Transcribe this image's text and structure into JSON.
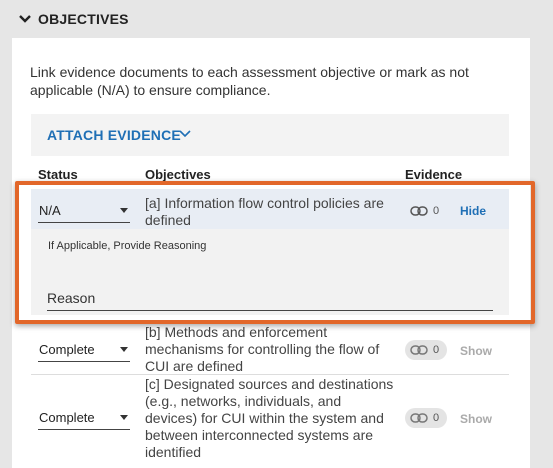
{
  "section": {
    "title": "OBJECTIVES"
  },
  "intro_text": "Link evidence documents to each assessment objective or mark as not applicable (N/A) to ensure compliance.",
  "attach": {
    "label": "ATTACH EVIDENCE"
  },
  "table": {
    "headers": {
      "status": "Status",
      "objectives": "Objectives",
      "evidence": "Evidence"
    },
    "rows": [
      {
        "status": "N/A",
        "objective": "[a] Information flow control policies are defined",
        "evidence_count": "0",
        "toggle": "Hide"
      },
      {
        "status": "Complete",
        "objective": "[b] Methods and enforcement mechanisms for controlling the flow of CUI are defined",
        "evidence_count": "0",
        "toggle": "Show"
      },
      {
        "status": "Complete",
        "objective": "[c] Designated sources and destinations (e.g., networks, individuals, and devices) for CUI within the system and between interconnected systems are identified",
        "evidence_count": "0",
        "toggle": "Show"
      }
    ]
  },
  "reasoning": {
    "label": "If Applicable, Provide Reasoning",
    "placeholder": "Reason"
  },
  "colors": {
    "accent": "#1f6fb5",
    "highlight": "#e2672a",
    "selected_row": "#e8edf4"
  }
}
